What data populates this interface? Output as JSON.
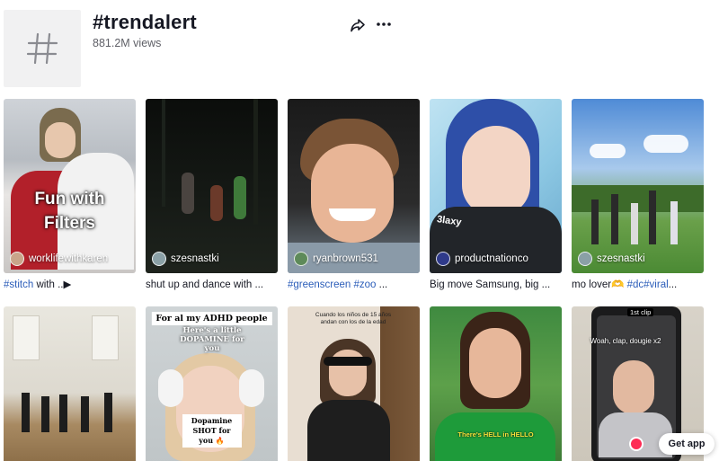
{
  "header": {
    "title": "#trendalert",
    "views": "881.2M views"
  },
  "videos": [
    {
      "author": "worklifewithkaren",
      "caption_tag": "#stitch",
      "caption_text": " with ..▶",
      "overlay": "Fun with Filters"
    },
    {
      "author": "szesnastki",
      "caption_tag": "",
      "caption_text": "shut up and dance with ..."
    },
    {
      "author": "ryanbrown531",
      "caption_tag": "#greenscreen #zoo",
      "caption_text": " ..."
    },
    {
      "author": "productnationco",
      "caption_tag": "",
      "caption_text": "Big move Samsung, big ...",
      "overlay": "3laxy"
    },
    {
      "author": "szesnastki",
      "caption_tag": "#dc#viral",
      "caption_text_before": "mo lover🫶 ",
      "caption_text": "..."
    },
    {
      "overlay_top": "For al my ADHD people",
      "overlay_mid": "Here's a little DOPAMINE for you",
      "overlay_bottom": "Dopamine SHOT for you 🔥"
    },
    {
      "overlay_top": "Cuando los niños de 15 años andan con los de la edad"
    },
    {
      "overlay_bottom": "There's HELL in HELLO"
    },
    {
      "overlay_top": "1st clip",
      "overlay_mid": "Woah, clap, dougie x2"
    },
    {}
  ],
  "get_app": "Get app",
  "colors": {
    "hashtag_link": "#2b5db9",
    "muted": "#5e5f66"
  }
}
